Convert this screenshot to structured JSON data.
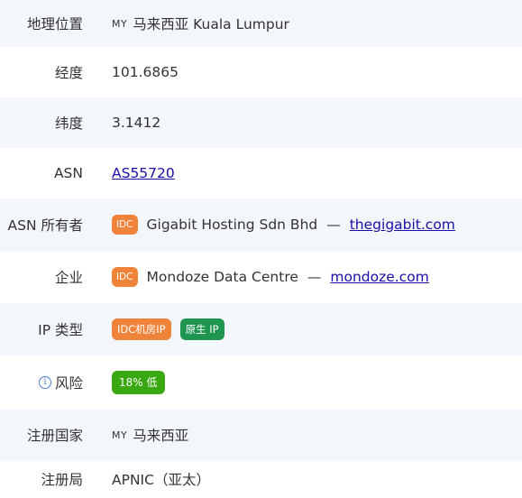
{
  "rows": {
    "location": {
      "label": "地理位置",
      "country_code": "MY",
      "value": "马来西亚 Kuala Lumpur"
    },
    "longitude": {
      "label": "经度",
      "value": "101.6865"
    },
    "latitude": {
      "label": "纬度",
      "value": "3.1412"
    },
    "asn": {
      "label": "ASN",
      "value": "AS55720"
    },
    "asn_owner": {
      "label": "ASN 所有者",
      "badge": "IDC",
      "name": "Gigabit Hosting Sdn Bhd",
      "separator": "—",
      "domain": "thegigabit.com"
    },
    "company": {
      "label": "企业",
      "badge": "IDC",
      "name": "Mondoze Data Centre",
      "separator": "—",
      "domain": "mondoze.com"
    },
    "ip_type": {
      "label": "IP 类型",
      "badges": [
        "IDC机房IP",
        "原生 IP"
      ]
    },
    "risk": {
      "label": "风险",
      "icon": "info-icon",
      "value": "18% 低",
      "percent": 18
    },
    "reg_country": {
      "label": "注册国家",
      "country_code": "MY",
      "value": "马来西亚"
    },
    "registry": {
      "label": "注册局",
      "value": "APNIC（亚太）"
    }
  },
  "colors": {
    "row_alt_bg": "#f3f6fb",
    "idc_orange": "#f0833a",
    "native_green": "#1e9650",
    "risk_green": "#3aa810",
    "link": "#1a0dab"
  }
}
